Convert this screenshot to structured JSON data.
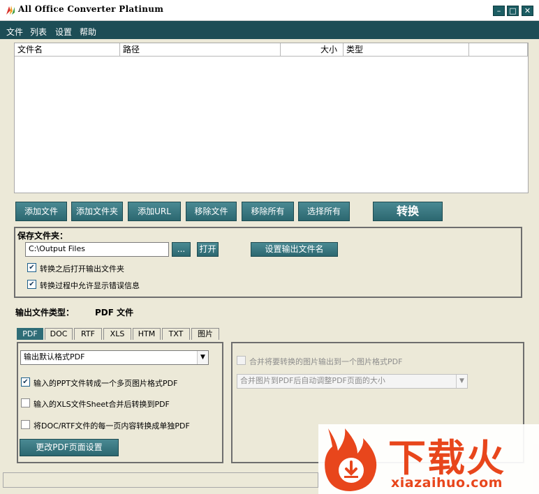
{
  "window": {
    "title": "All Office Converter Platinum"
  },
  "menu": [
    "文件",
    "列表",
    "设置",
    "帮助"
  ],
  "file_list": {
    "columns": [
      "文件名",
      "路径",
      "大小",
      "类型"
    ]
  },
  "toolbar": {
    "add_file": "添加文件",
    "add_folder": "添加文件夹",
    "add_url": "添加URL",
    "remove_file": "移除文件",
    "remove_all": "移除所有",
    "select_all": "选择所有",
    "convert": "转换"
  },
  "save_folder": {
    "title": "保存文件夹：",
    "path_value": "C:\\Output Files",
    "browse_label": "...",
    "open_label": "打开",
    "set_output_name_label": "设置输出文件名",
    "open_after_convert": {
      "label": "转换之后打开输出文件夹",
      "checked": true
    },
    "show_errors": {
      "label": "转换过程中允许显示错误信息",
      "checked": true
    }
  },
  "output_type": {
    "label": "输出文件类型：",
    "value": "PDF 文件"
  },
  "tabs": [
    "PDF",
    "DOC",
    "RTF",
    "XLS",
    "HTM",
    "TXT",
    "图片"
  ],
  "pdf_options": {
    "format_select": "输出默认格式PDF",
    "ppt_to_image_pdf": {
      "label": "输入的PPT文件转成一个多页图片格式PDF",
      "checked": true
    },
    "xls_merge_sheets": {
      "label": "输入的XLS文件Sheet合并后转换到PDF",
      "checked": false
    },
    "split_pages": {
      "label": "将DOC/RTF文件的每一页内容转换成单独PDF",
      "checked": false
    },
    "page_settings_button": "更改PDF页面设置"
  },
  "image_options": {
    "merge_images": {
      "label": "合并将要转换的图片输出到一个图片格式PDF",
      "checked": false
    },
    "auto_resize_select": "合并图片到PDF后自动调整PDF页面的大小"
  },
  "watermark": {
    "brand_text": "下载火",
    "domain_text": "xiazaihuo.com"
  },
  "colors": {
    "menubar": "#1d4d56",
    "button": "#2c6770",
    "accent_orange": "#e8461c"
  }
}
